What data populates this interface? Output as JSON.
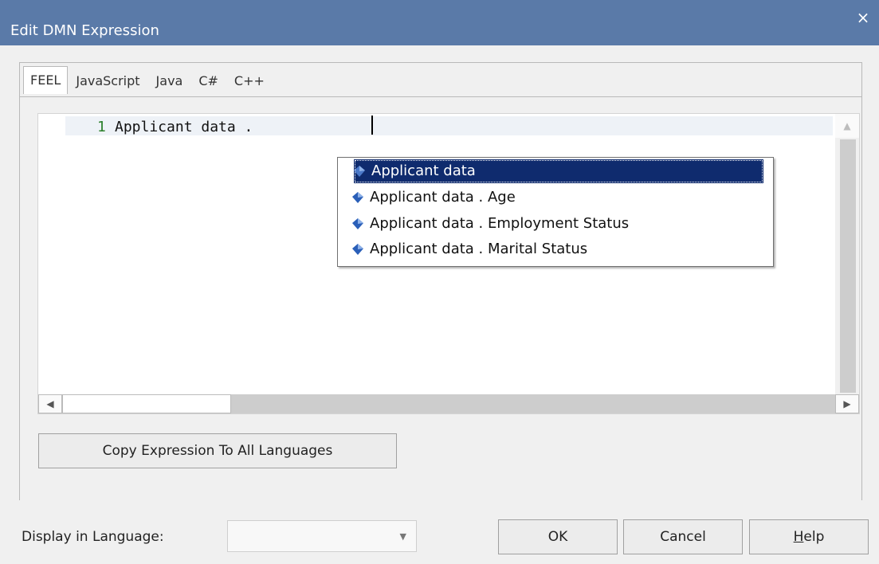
{
  "window": {
    "title": "Edit DMN Expression",
    "close_glyph": "×"
  },
  "tabs": [
    {
      "label": "FEEL",
      "active": true
    },
    {
      "label": "JavaScript",
      "active": false
    },
    {
      "label": "Java",
      "active": false
    },
    {
      "label": "C#",
      "active": false
    },
    {
      "label": "C++",
      "active": false
    }
  ],
  "editor": {
    "line_number": "1",
    "code": "Applicant data . "
  },
  "autocomplete": {
    "items": [
      {
        "label": "Applicant data",
        "selected": true
      },
      {
        "label": "Applicant data . Age",
        "selected": false
      },
      {
        "label": "Applicant data . Employment Status",
        "selected": false
      },
      {
        "label": "Applicant data . Marital Status",
        "selected": false
      }
    ],
    "icon": "blue-gem-icon"
  },
  "copy_button": {
    "label": "Copy Expression To All Languages"
  },
  "bottom": {
    "display_label": "Display in Language:",
    "select_value": "",
    "ok_label": "OK",
    "cancel_label": "Cancel",
    "help_label_rest": "elp",
    "help_mnemonic": "H"
  },
  "colors": {
    "titlebar": "#5a7aa8",
    "selection": "#0f2b6e",
    "line_number": "#2a7f2a"
  }
}
